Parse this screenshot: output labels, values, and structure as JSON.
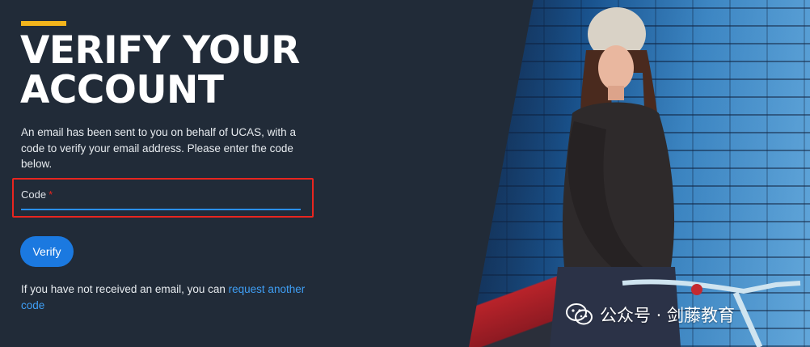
{
  "page": {
    "title": "VERIFY YOUR ACCOUNT",
    "description": "An email has been sent to you on behalf of UCAS, with a code to verify your email address. Please enter the code below."
  },
  "form": {
    "code_label": "Code",
    "required_marker": "*",
    "code_value": "",
    "verify_label": "Verify"
  },
  "resend": {
    "prefix": "If you have not received an email, you can ",
    "link_text": "request another code"
  },
  "watermark": {
    "text": "公众号 · 剑藤教育",
    "icon": "wechat-icon"
  },
  "colors": {
    "accent": "#f2b41c",
    "primary": "#1b79e0",
    "link": "#3f9ff5",
    "highlight_border": "#e8251f",
    "background": "#212b38"
  }
}
